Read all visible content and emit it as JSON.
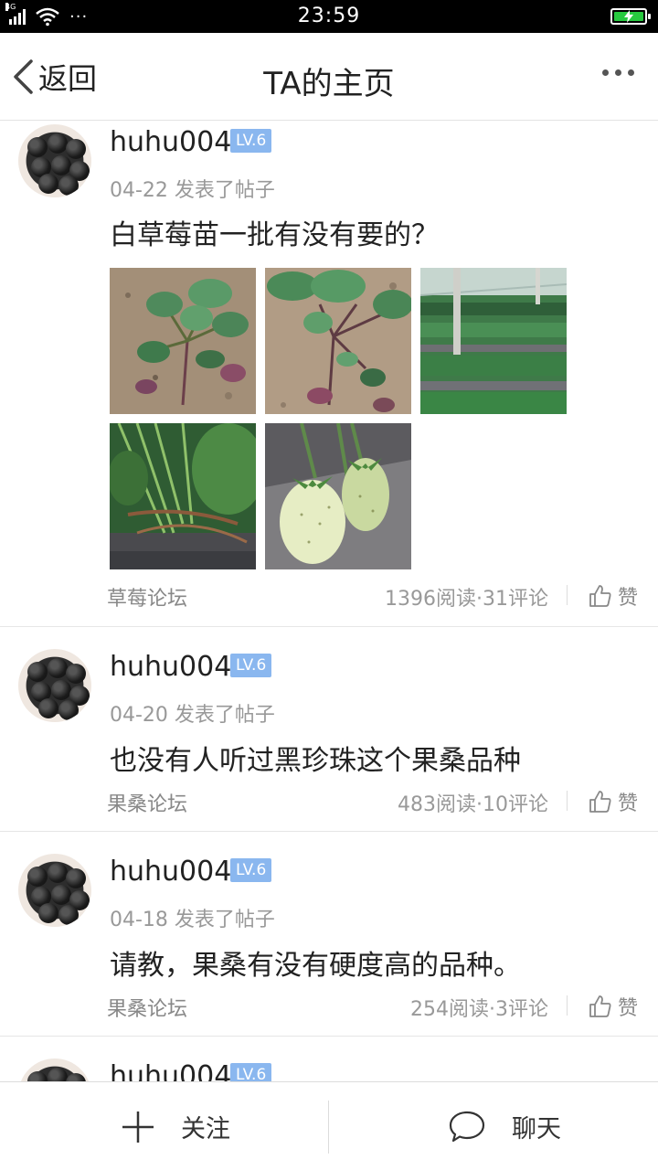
{
  "status_bar": {
    "network": "4G",
    "time": "23:59",
    "more": "···"
  },
  "header": {
    "back_label": "返回",
    "title": "TA的主页"
  },
  "posts": [
    {
      "username": "huhu004",
      "level": "LV.6",
      "meta": "04-22  发表了帖子",
      "title": "白草莓苗一批有没有要的？",
      "forum": "草莓论坛",
      "stats": "1396阅读·31评论",
      "like_label": "赞",
      "photos": [
        "strawberry-seedling-1",
        "strawberry-seedling-2",
        "greenhouse-rows",
        "strawberry-plant-closeup",
        "white-strawberries"
      ]
    },
    {
      "username": "huhu004",
      "level": "LV.6",
      "meta": "04-20  发表了帖子",
      "title": "也没有人听过黑珍珠这个果桑品种",
      "forum": "果桑论坛",
      "stats": "483阅读·10评论",
      "like_label": "赞"
    },
    {
      "username": "huhu004",
      "level": "LV.6",
      "meta": "04-18  发表了帖子",
      "title": "请教，果桑有没有硬度高的品种。",
      "forum": "果桑论坛",
      "stats": "254阅读·3评论",
      "like_label": "赞"
    },
    {
      "username": "huhu004",
      "level": "LV.6"
    }
  ],
  "bottom_bar": {
    "follow_label": "关注",
    "chat_label": "聊天"
  },
  "colors": {
    "level_badge": "#8ab7ef",
    "battery": "#27c93f",
    "status_bar_bg": "#000000"
  }
}
